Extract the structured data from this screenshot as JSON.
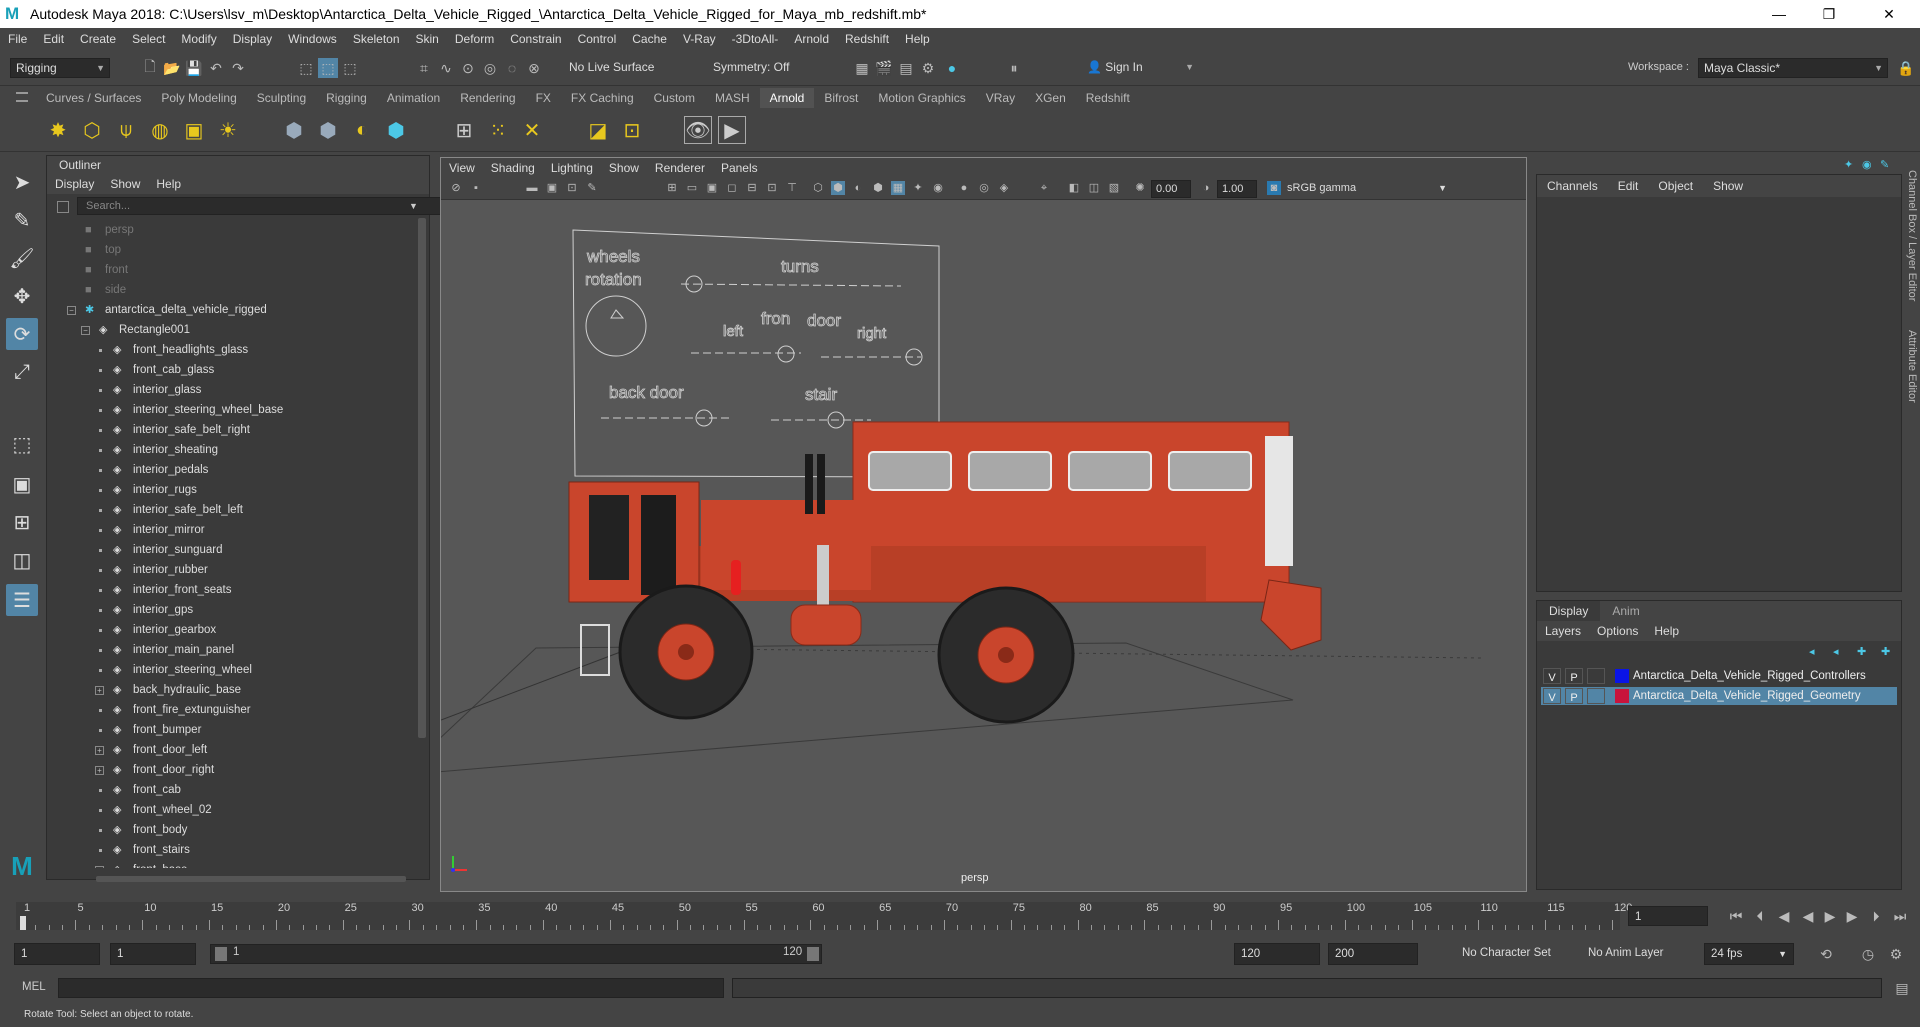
{
  "window": {
    "title": "Autodesk Maya 2018: C:\\Users\\lsv_m\\Desktop\\Antarctica_Delta_Vehicle_Rigged_\\Antarctica_Delta_Vehicle_Rigged_for_Maya_mb_redshift.mb*",
    "minimize": "—",
    "restore": "❐",
    "close": "✕"
  },
  "menubar": [
    "File",
    "Edit",
    "Create",
    "Select",
    "Modify",
    "Display",
    "Windows",
    "Skeleton",
    "Skin",
    "Deform",
    "Constrain",
    "Control",
    "Cache",
    "V-Ray",
    "-3DtoAll-",
    "Arnold",
    "Redshift",
    "Help"
  ],
  "status": {
    "menuset": "Rigging",
    "live_surface": "No Live Surface",
    "symmetry": "Symmetry: Off",
    "sign_in": "Sign In",
    "workspace_label": "Workspace :",
    "workspace": "Maya Classic*"
  },
  "shelf_tabs": [
    "Curves / Surfaces",
    "Poly Modeling",
    "Sculpting",
    "Rigging",
    "Animation",
    "Rendering",
    "FX",
    "FX Caching",
    "Custom",
    "MASH",
    "Arnold",
    "Bifrost",
    "Motion Graphics",
    "VRay",
    "XGen",
    "Redshift"
  ],
  "shelf_active": "Arnold",
  "outliner": {
    "title": "Outliner",
    "menu": [
      "Display",
      "Show",
      "Help"
    ],
    "search_placeholder": "Search...",
    "cameras": [
      "persp",
      "top",
      "front",
      "side"
    ],
    "root": "antarctica_delta_vehicle_rigged",
    "group": "Rectangle001",
    "items": [
      {
        "name": "front_headlights_glass",
        "exp": false
      },
      {
        "name": "front_cab_glass",
        "exp": false
      },
      {
        "name": "interior_glass",
        "exp": false
      },
      {
        "name": "interior_steering_wheel_base",
        "exp": false
      },
      {
        "name": "interior_safe_belt_right",
        "exp": false
      },
      {
        "name": "interior_sheating",
        "exp": false
      },
      {
        "name": "interior_pedals",
        "exp": false
      },
      {
        "name": "interior_rugs",
        "exp": false
      },
      {
        "name": "interior_safe_belt_left",
        "exp": false
      },
      {
        "name": "interior_mirror",
        "exp": false
      },
      {
        "name": "interior_sunguard",
        "exp": false
      },
      {
        "name": "interior_rubber",
        "exp": false
      },
      {
        "name": "interior_front_seats",
        "exp": false
      },
      {
        "name": "interior_gps",
        "exp": false
      },
      {
        "name": "interior_gearbox",
        "exp": false
      },
      {
        "name": "interior_main_panel",
        "exp": false
      },
      {
        "name": "interior_steering_wheel",
        "exp": false
      },
      {
        "name": "back_hydraulic_base",
        "exp": true
      },
      {
        "name": "front_fire_extunguisher",
        "exp": false
      },
      {
        "name": "front_bumper",
        "exp": false
      },
      {
        "name": "front_door_left",
        "exp": true
      },
      {
        "name": "front_door_right",
        "exp": true
      },
      {
        "name": "front_cab",
        "exp": false
      },
      {
        "name": "front_wheel_02",
        "exp": false
      },
      {
        "name": "front_body",
        "exp": false
      },
      {
        "name": "front_stairs",
        "exp": false
      },
      {
        "name": "front_base",
        "exp": true
      }
    ]
  },
  "viewport": {
    "menu": [
      "View",
      "Shading",
      "Lighting",
      "Show",
      "Renderer",
      "Panels"
    ],
    "exposure": "0.00",
    "gamma": "1.00",
    "color_space": "sRGB gamma",
    "camera_label": "persp",
    "controls": {
      "wheels": "wheels",
      "rotation": "rotation",
      "turns": "turns",
      "left": "left",
      "fron": "fron",
      "door": "door",
      "right": "right",
      "back_door": "back door",
      "stair": "stair"
    }
  },
  "channelbox": {
    "menu": [
      "Channels",
      "Edit",
      "Object",
      "Show"
    ]
  },
  "layer_editor": {
    "tabs": [
      "Display",
      "Anim"
    ],
    "menu": [
      "Layers",
      "Options",
      "Help"
    ],
    "layers": [
      {
        "v": "V",
        "p": "P",
        "color": "#0a14e6",
        "name": "Antarctica_Delta_Vehicle_Rigged_Controllers",
        "selected": false
      },
      {
        "v": "V",
        "p": "P",
        "color": "#c8143c",
        "name": "Antarctica_Delta_Vehicle_Rigged_Geometry",
        "selected": true
      }
    ]
  },
  "right_strip": {
    "channel_box": "Channel Box / Layer Editor",
    "attr": "Attribute Editor"
  },
  "timeline": {
    "ticks": [
      "1",
      "5",
      "10",
      "15",
      "20",
      "25",
      "30",
      "35",
      "40",
      "45",
      "50",
      "55",
      "60",
      "65",
      "70",
      "75",
      "80",
      "85",
      "90",
      "95",
      "100",
      "105",
      "110",
      "115",
      "120"
    ],
    "current_frame": "1"
  },
  "range": {
    "start": "1",
    "playback_start": "1",
    "slider_start": "1",
    "slider_end": "120",
    "playback_end": "120",
    "end": "200",
    "char_set": "No Character Set",
    "anim_layer": "No Anim Layer",
    "fps": "24 fps"
  },
  "cmd": {
    "label": "MEL"
  },
  "help_line": "Rotate Tool: Select an object to rotate."
}
